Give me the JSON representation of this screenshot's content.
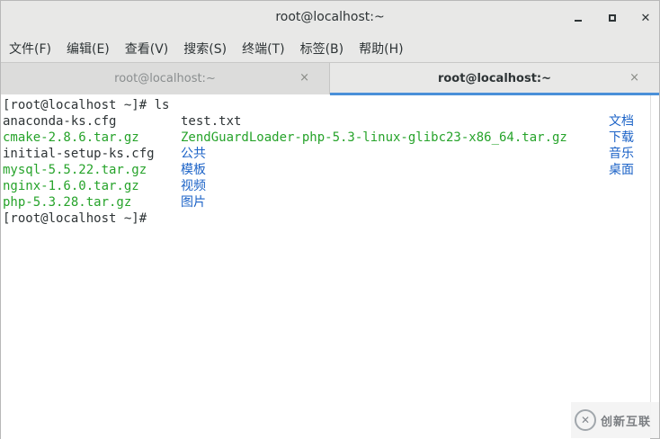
{
  "window": {
    "title": "root@localhost:~"
  },
  "icons": {
    "minimize": "minimize-icon",
    "maximize": "maximize-icon",
    "close": "close-icon"
  },
  "menu": {
    "items": [
      "文件(F)",
      "编辑(E)",
      "查看(V)",
      "搜索(S)",
      "终端(T)",
      "标签(B)",
      "帮助(H)"
    ]
  },
  "tabs": [
    {
      "label": "root@localhost:~",
      "active": false,
      "close": "×"
    },
    {
      "label": "root@localhost:~",
      "active": true,
      "close": "×"
    }
  ],
  "terminal": {
    "prompt_command": "[root@localhost ~]# ls",
    "listing": [
      [
        {
          "text": "anaconda-ks.cfg",
          "type": "plain"
        },
        {
          "text": "test.txt",
          "type": "plain"
        },
        {
          "text": "文档",
          "type": "dir"
        }
      ],
      [
        {
          "text": "cmake-2.8.6.tar.gz",
          "type": "exec"
        },
        {
          "text": "ZendGuardLoader-php-5.3-linux-glibc23-x86_64.tar.gz",
          "type": "exec"
        },
        {
          "text": "下载",
          "type": "dir"
        }
      ],
      [
        {
          "text": "initial-setup-ks.cfg",
          "type": "plain"
        },
        {
          "text": "公共",
          "type": "dir"
        },
        {
          "text": "音乐",
          "type": "dir"
        }
      ],
      [
        {
          "text": "mysql-5.5.22.tar.gz",
          "type": "exec"
        },
        {
          "text": "模板",
          "type": "dir"
        },
        {
          "text": "桌面",
          "type": "dir"
        }
      ],
      [
        {
          "text": "nginx-1.6.0.tar.gz",
          "type": "exec"
        },
        {
          "text": "视频",
          "type": "dir"
        }
      ],
      [
        {
          "text": "php-5.3.28.tar.gz",
          "type": "exec"
        },
        {
          "text": "图片",
          "type": "dir"
        }
      ]
    ],
    "final_prompt": "[root@localhost ~]# "
  },
  "colors": {
    "executable": "#26a32a",
    "directory": "#1c63c7",
    "text": "#2e3436",
    "accent": "#4a90d9"
  },
  "watermark": {
    "text": "创新互联"
  }
}
